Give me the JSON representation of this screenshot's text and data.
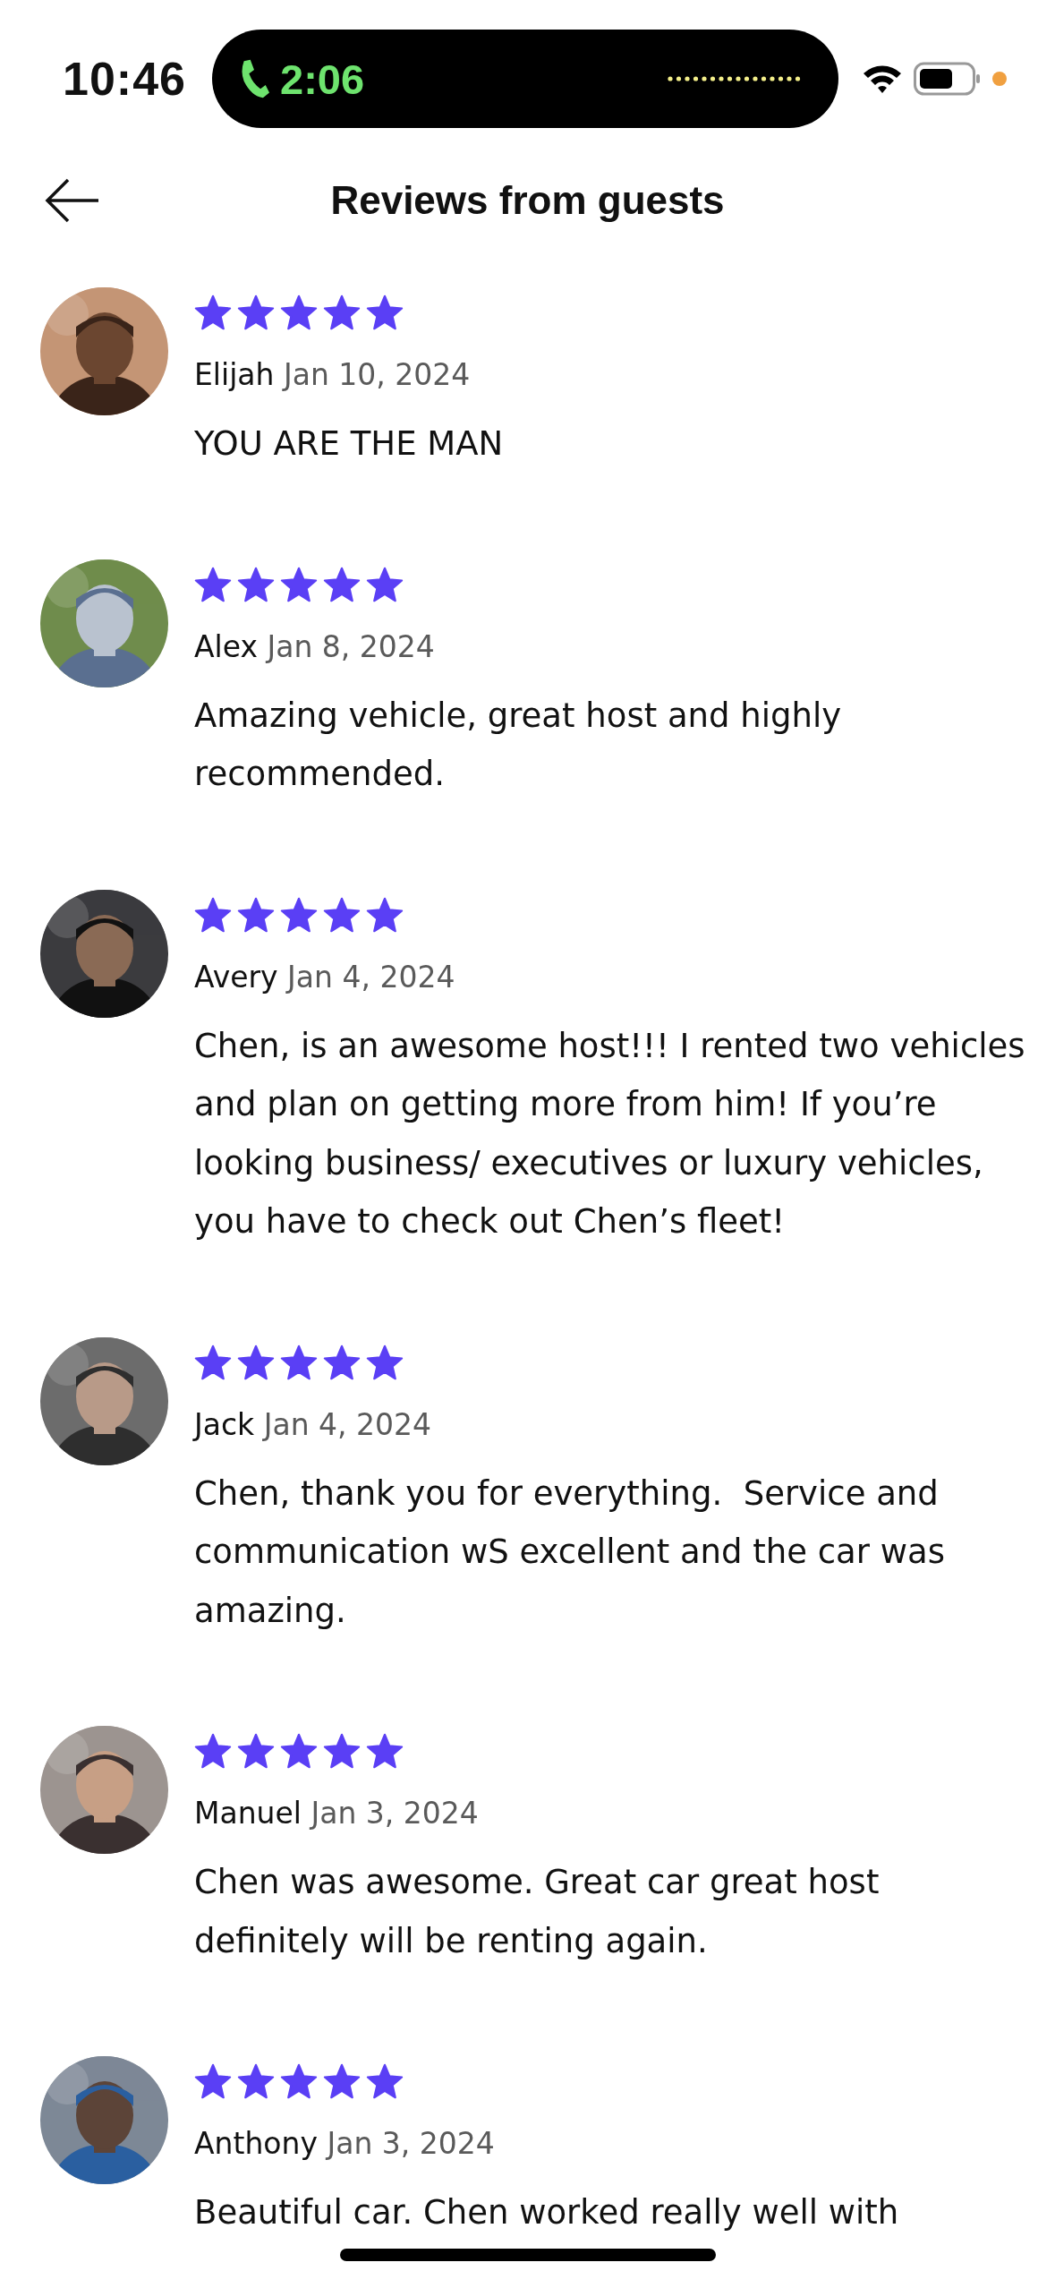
{
  "status_bar": {
    "time": "10:46",
    "call_timer": "2:06"
  },
  "header": {
    "title": "Reviews from guests"
  },
  "reviews": [
    {
      "name": "Elijah",
      "date": "Jan 10, 2024",
      "text": "YOU ARE THE MAN",
      "stars": 5
    },
    {
      "name": "Alex",
      "date": "Jan 8, 2024",
      "text": "Amazing vehicle, great host and highly recommended.",
      "stars": 5
    },
    {
      "name": "Avery",
      "date": "Jan 4, 2024",
      "text": "Chen, is an awesome host!!! I rented two vehicles and plan on getting more from him! If you’re looking business/ executives or luxury vehicles, you have to check out Chen’s fleet!",
      "stars": 5
    },
    {
      "name": "Jack",
      "date": "Jan 4, 2024",
      "text": "Chen, thank you for everything.  Service and communication wS excellent and the car was amazing.",
      "stars": 5
    },
    {
      "name": "Manuel",
      "date": "Jan 3, 2024",
      "text": "Chen was awesome. Great car great host definitely will be renting again.",
      "stars": 5
    },
    {
      "name": "Anthony",
      "date": "Jan 3, 2024",
      "text": "Beautiful car. Chen worked really well with",
      "stars": 5
    }
  ]
}
